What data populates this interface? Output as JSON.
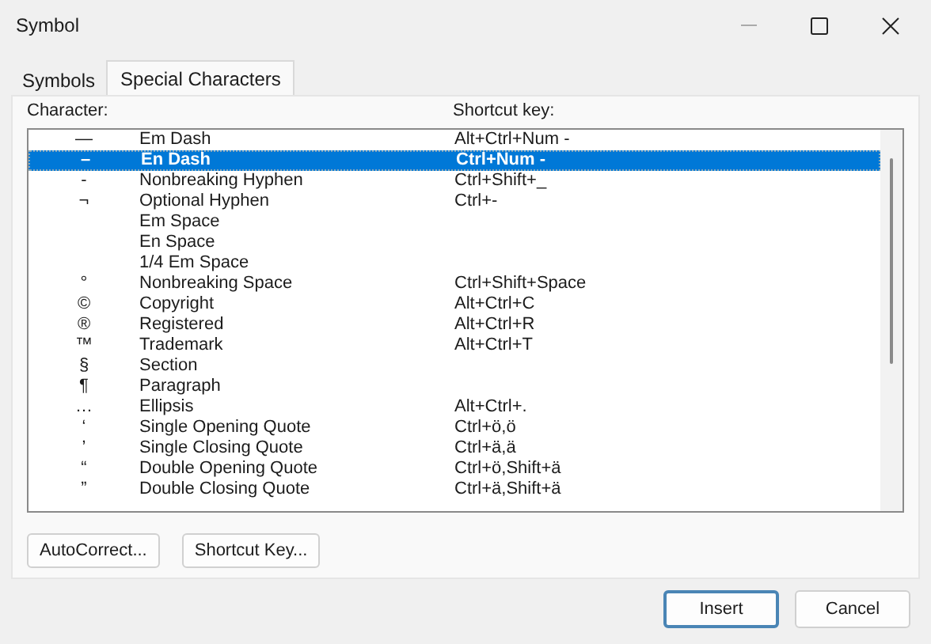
{
  "window": {
    "title": "Symbol"
  },
  "tabs": [
    {
      "label": "Symbols",
      "selected": false
    },
    {
      "label": "Special Characters",
      "selected": true
    }
  ],
  "list": {
    "columns": [
      "Character:",
      "Shortcut key:"
    ],
    "rows": [
      {
        "character": "—",
        "name": "Em Dash",
        "shortcut": "Alt+Ctrl+Num -",
        "selected": false
      },
      {
        "character": "–",
        "name": "En Dash",
        "shortcut": "Ctrl+Num -",
        "selected": true
      },
      {
        "character": "-",
        "name": "Nonbreaking Hyphen",
        "shortcut": "Ctrl+Shift+_",
        "selected": false
      },
      {
        "character": "¬",
        "name": "Optional Hyphen",
        "shortcut": "Ctrl+-",
        "selected": false
      },
      {
        "name": "Em Space",
        "selected": false
      },
      {
        "name": "En Space",
        "selected": false
      },
      {
        "name": "1/4 Em Space",
        "selected": false
      },
      {
        "character": "°",
        "name": "Nonbreaking Space",
        "shortcut": "Ctrl+Shift+Space",
        "selected": false
      },
      {
        "character": "©",
        "name": "Copyright",
        "shortcut": "Alt+Ctrl+C",
        "selected": false
      },
      {
        "character": "®",
        "name": "Registered",
        "shortcut": "Alt+Ctrl+R",
        "selected": false
      },
      {
        "character": "™",
        "name": "Trademark",
        "shortcut": "Alt+Ctrl+T",
        "selected": false
      },
      {
        "character": "§",
        "name": "Section",
        "selected": false
      },
      {
        "character": "¶",
        "name": "Paragraph",
        "selected": false
      },
      {
        "character": "…",
        "name": "Ellipsis",
        "shortcut": "Alt+Ctrl+.",
        "selected": false
      },
      {
        "character": "‘",
        "name": "Single Opening Quote",
        "shortcut": "Ctrl+ö,ö",
        "selected": false
      },
      {
        "character": "’",
        "name": "Single Closing Quote",
        "shortcut": "Ctrl+ä,ä",
        "selected": false
      },
      {
        "character": "“",
        "name": "Double Opening Quote",
        "shortcut": "Ctrl+ö,Shift+ä",
        "selected": false
      },
      {
        "character": "”",
        "name": "Double Closing Quote",
        "shortcut": "Ctrl+ä,Shift+ä",
        "selected": false
      }
    ]
  },
  "panel_buttons": [
    "AutoCorrect...",
    "Shortcut Key..."
  ],
  "dialog_buttons": [
    {
      "label": "Insert",
      "default": true
    },
    {
      "label": "Cancel",
      "default": false
    }
  ]
}
